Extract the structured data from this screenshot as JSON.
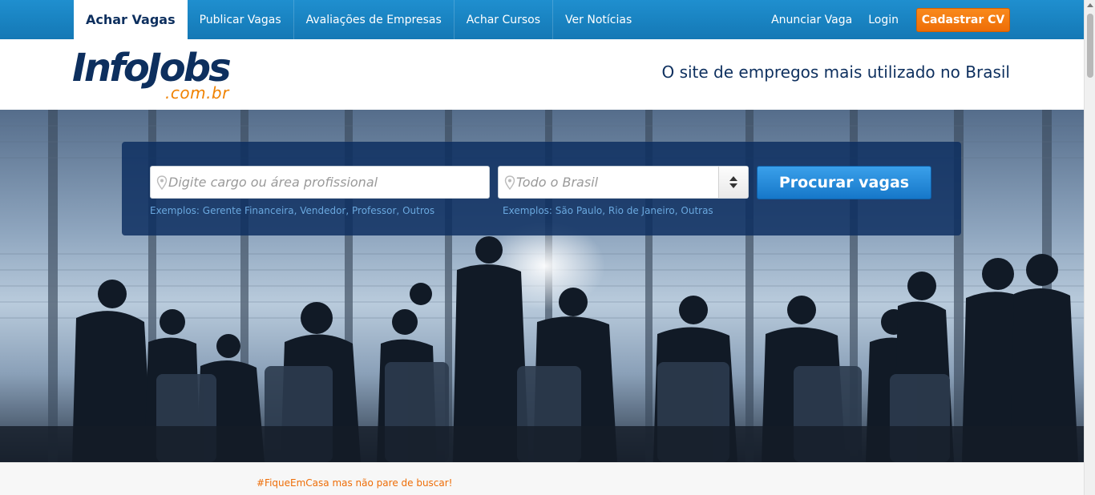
{
  "nav": {
    "tabs": [
      {
        "label": "Achar Vagas",
        "active": true
      },
      {
        "label": "Publicar Vagas"
      },
      {
        "label": "Avaliações de Empresas"
      },
      {
        "label": "Achar Cursos"
      },
      {
        "label": "Ver Notícias"
      }
    ],
    "anunciar": "Anunciar Vaga",
    "login": "Login",
    "cadastrar": "Cadastrar CV"
  },
  "header": {
    "logo_main": "InfoJobs",
    "logo_sub": ".com.br",
    "tagline": "O site de empregos mais utilizado no Brasil"
  },
  "search": {
    "cargo_placeholder": "Digite cargo ou área profissional",
    "local_placeholder": "Todo o Brasil",
    "button": "Procurar vagas",
    "cargo_examples": [
      "Exemplos:",
      "Gerente Financeira,",
      "Vendedor,",
      "Professor,",
      "Outros"
    ],
    "local_examples": [
      "Exemplos:",
      "São Paulo,",
      "Rio de Janeiro,",
      "Outras"
    ]
  },
  "promo": {
    "hashtag_line": "#FiqueEmCasa mas não pare de buscar!"
  },
  "colors": {
    "nav_blue": "#1a86c8",
    "brand_navy": "#0d2f5e",
    "brand_orange": "#f08200",
    "button_blue": "#1b86d6"
  }
}
